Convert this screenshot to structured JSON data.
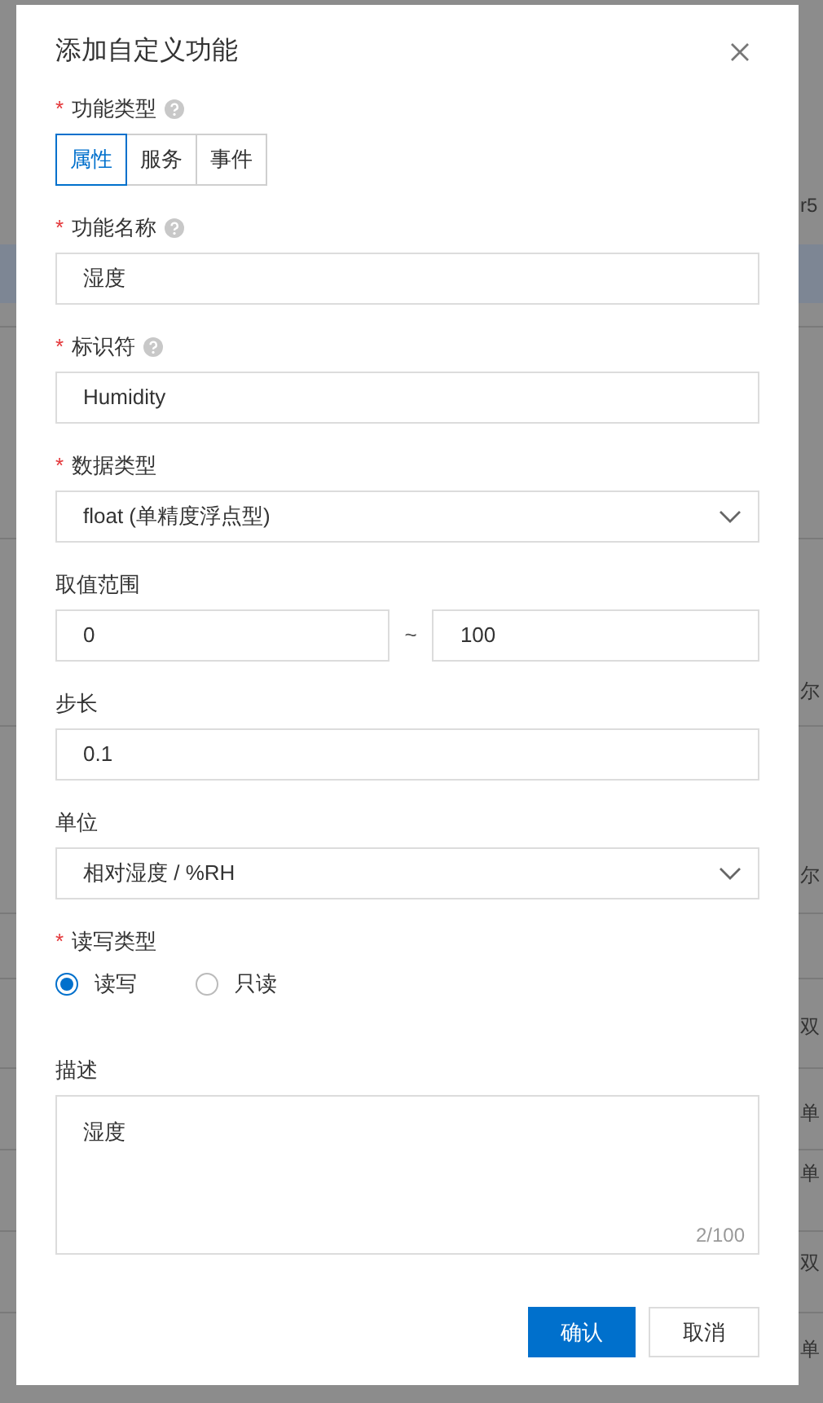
{
  "background": {
    "right_fragments": [
      "r5",
      "尔",
      "尔",
      "双",
      "单",
      "单",
      "双",
      "单"
    ]
  },
  "dialog": {
    "title": "添加自定义功能",
    "fields": [
      {
        "kind": "segmented",
        "label": "功能类型",
        "required_mark": "*",
        "help": true,
        "options": [
          {
            "label": "属性",
            "selected": true
          },
          {
            "label": "服务",
            "selected": false
          },
          {
            "label": "事件",
            "selected": false
          }
        ]
      },
      {
        "kind": "input",
        "label": "功能名称",
        "required_mark": "*",
        "help": true,
        "value": "湿度"
      },
      {
        "kind": "input",
        "label": "标识符",
        "required_mark": "*",
        "help": true,
        "value": "Humidity"
      },
      {
        "kind": "select",
        "label": "数据类型",
        "required_mark": "*",
        "value": "float (单精度浮点型)"
      },
      {
        "kind": "range",
        "label": "取值范围",
        "min": "0",
        "separator": "~",
        "max": "100"
      },
      {
        "kind": "input",
        "label": "步长",
        "value": "0.1"
      },
      {
        "kind": "select",
        "label": "单位",
        "value": "相对湿度 / %RH"
      },
      {
        "kind": "radio",
        "label": "读写类型",
        "required_mark": "*",
        "options": [
          {
            "label": "读写",
            "selected": true
          },
          {
            "label": "只读",
            "selected": false
          }
        ]
      },
      {
        "kind": "textarea",
        "label": "描述",
        "value": "湿度",
        "counter": "2/100"
      }
    ],
    "buttons": [
      {
        "label": "确认",
        "primary": true
      },
      {
        "label": "取消",
        "primary": false
      }
    ]
  }
}
